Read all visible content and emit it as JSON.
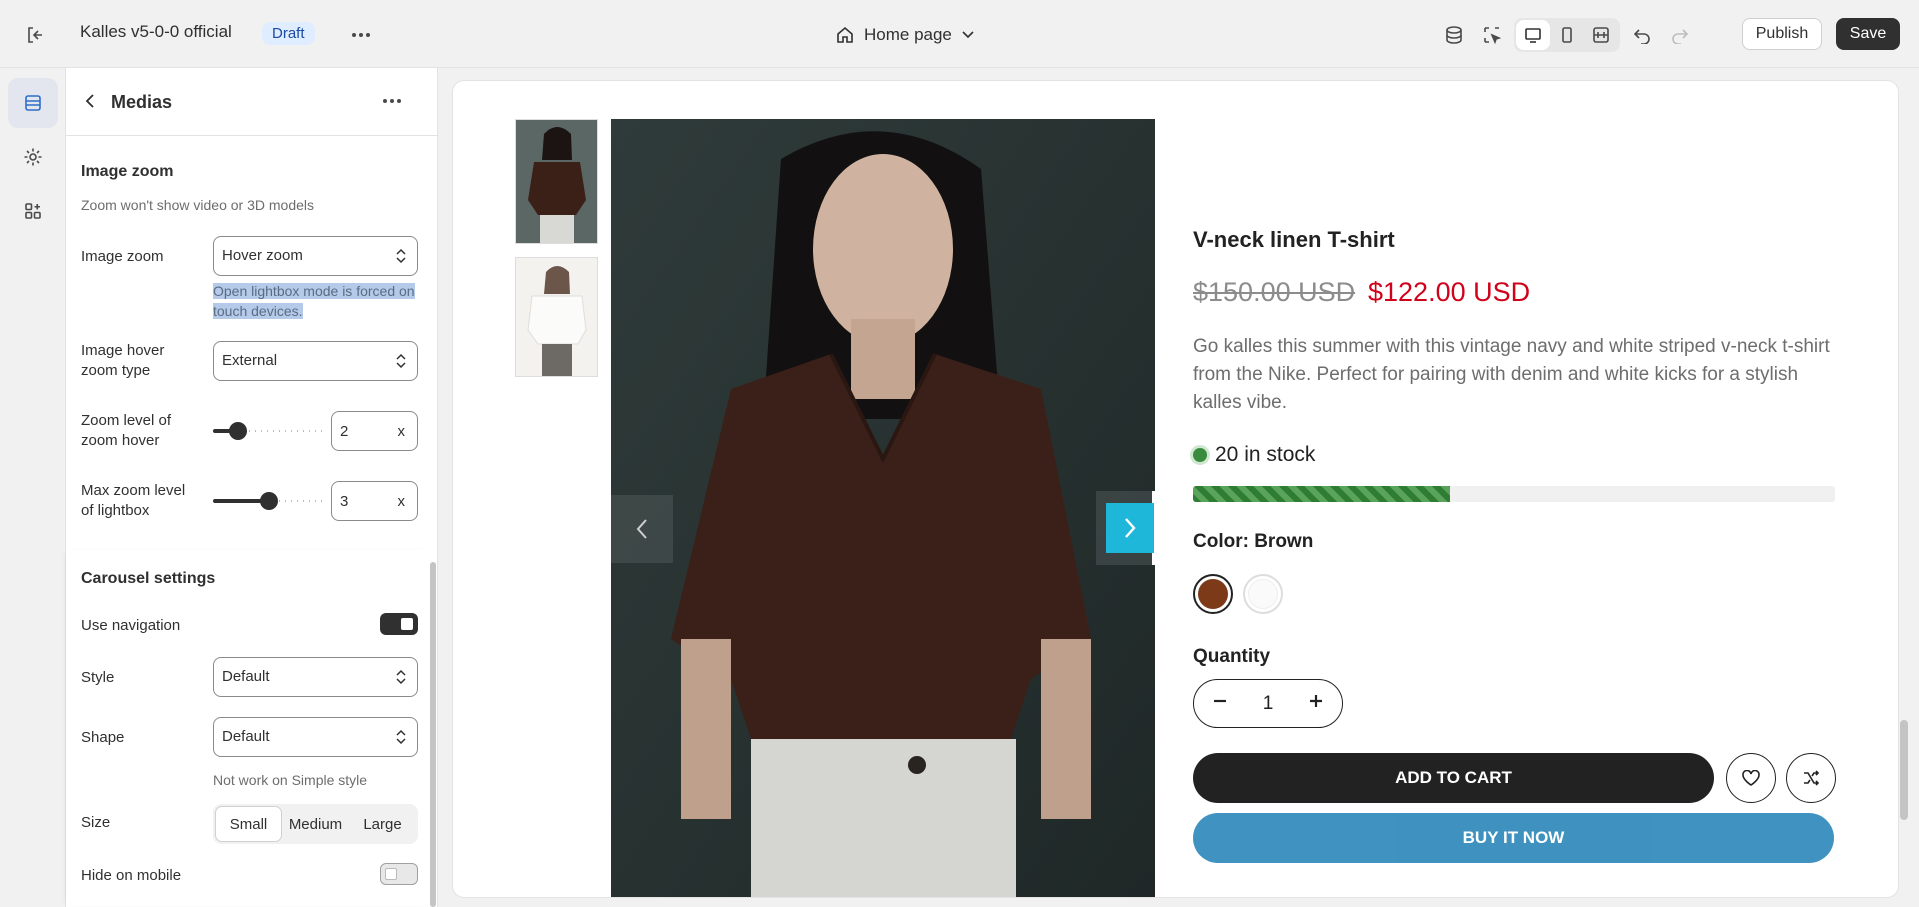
{
  "topbar": {
    "store_name": "Kalles v5-0-0 official",
    "status_badge": "Draft",
    "page_selector": "Home page",
    "publish_label": "Publish",
    "save_label": "Save"
  },
  "panel": {
    "title": "Medias",
    "image_zoom": {
      "section_title": "Image zoom",
      "section_desc": "Zoom won't show video or 3D models",
      "zoom_label": "Image zoom",
      "zoom_value": "Hover zoom",
      "zoom_hint": "Open lightbox mode is forced on touch devices.",
      "hover_type_label": "Image hover zoom type",
      "hover_type_value": "External",
      "zoom_level_label": "Zoom level of zoom hover",
      "zoom_level_value": "2",
      "zoom_level_unit": "x",
      "zoom_level_fraction": 0.17,
      "max_zoom_label": "Max zoom level of lightbox",
      "max_zoom_value": "3",
      "max_zoom_unit": "x",
      "max_zoom_fraction": 0.5
    },
    "carousel": {
      "section_title": "Carousel settings",
      "use_nav_label": "Use navigation",
      "use_nav_on": true,
      "style_label": "Style",
      "style_value": "Default",
      "shape_label": "Shape",
      "shape_value": "Default",
      "shape_hint": "Not work on Simple style",
      "size_label": "Size",
      "size_options": [
        "Small",
        "Medium",
        "Large"
      ],
      "size_selected": "Small",
      "hide_mobile_label": "Hide on mobile",
      "hide_mobile_on": false
    }
  },
  "product": {
    "title": "V-neck linen T-shirt",
    "old_price": "$150.00 USD",
    "new_price": "$122.00 USD",
    "description": "Go kalles this summer with this vintage navy and white striped v-neck t-shirt from the Nike. Perfect for pairing with denim and white kicks for a stylish kalles vibe.",
    "stock_text": "20 in stock",
    "stock_fraction": 0.4,
    "color_label": "Color: Brown",
    "quantity_label": "Quantity",
    "quantity_value": "1",
    "add_to_cart": "ADD TO CART",
    "buy_it_now": "BUY IT NOW"
  },
  "colors": {
    "accent_nav": "#1fb7d9",
    "sale_red": "#d0021b",
    "buy_blue": "#1e7fb5",
    "stock_green": "#2e7d32"
  }
}
